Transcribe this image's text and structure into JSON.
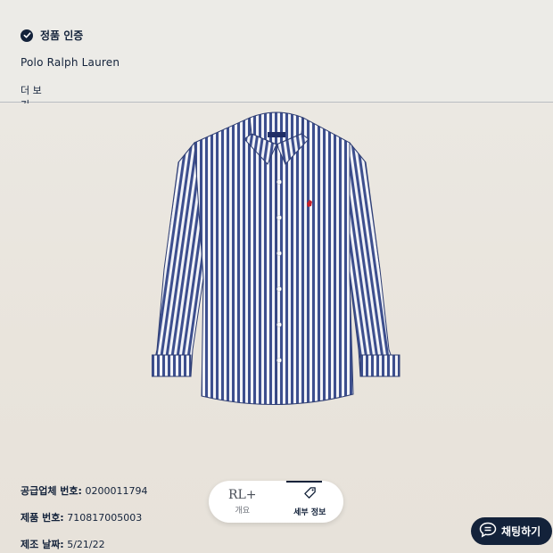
{
  "header": {
    "verified_label": "정품 인증",
    "brand": "Polo Ralph Lauren",
    "more_tab": "더 보기"
  },
  "product": {
    "image_alt": "Blue and white striped button-down shirt"
  },
  "details": [
    {
      "label": "공급업체 번호:",
      "value": "0200011794"
    },
    {
      "label": "제품 번호:",
      "value": "710817005003"
    },
    {
      "label": "제조 날짜:",
      "value": "5/21/22"
    }
  ],
  "bottom_nav": {
    "overview_logo": "RL+",
    "overview_label": "개요",
    "details_label": "세부 정보"
  },
  "chat": {
    "label": "채팅하기"
  },
  "colors": {
    "navy": "#13223a",
    "background": "#ece9e3",
    "shirt_stripe": "#3d4f8e"
  }
}
